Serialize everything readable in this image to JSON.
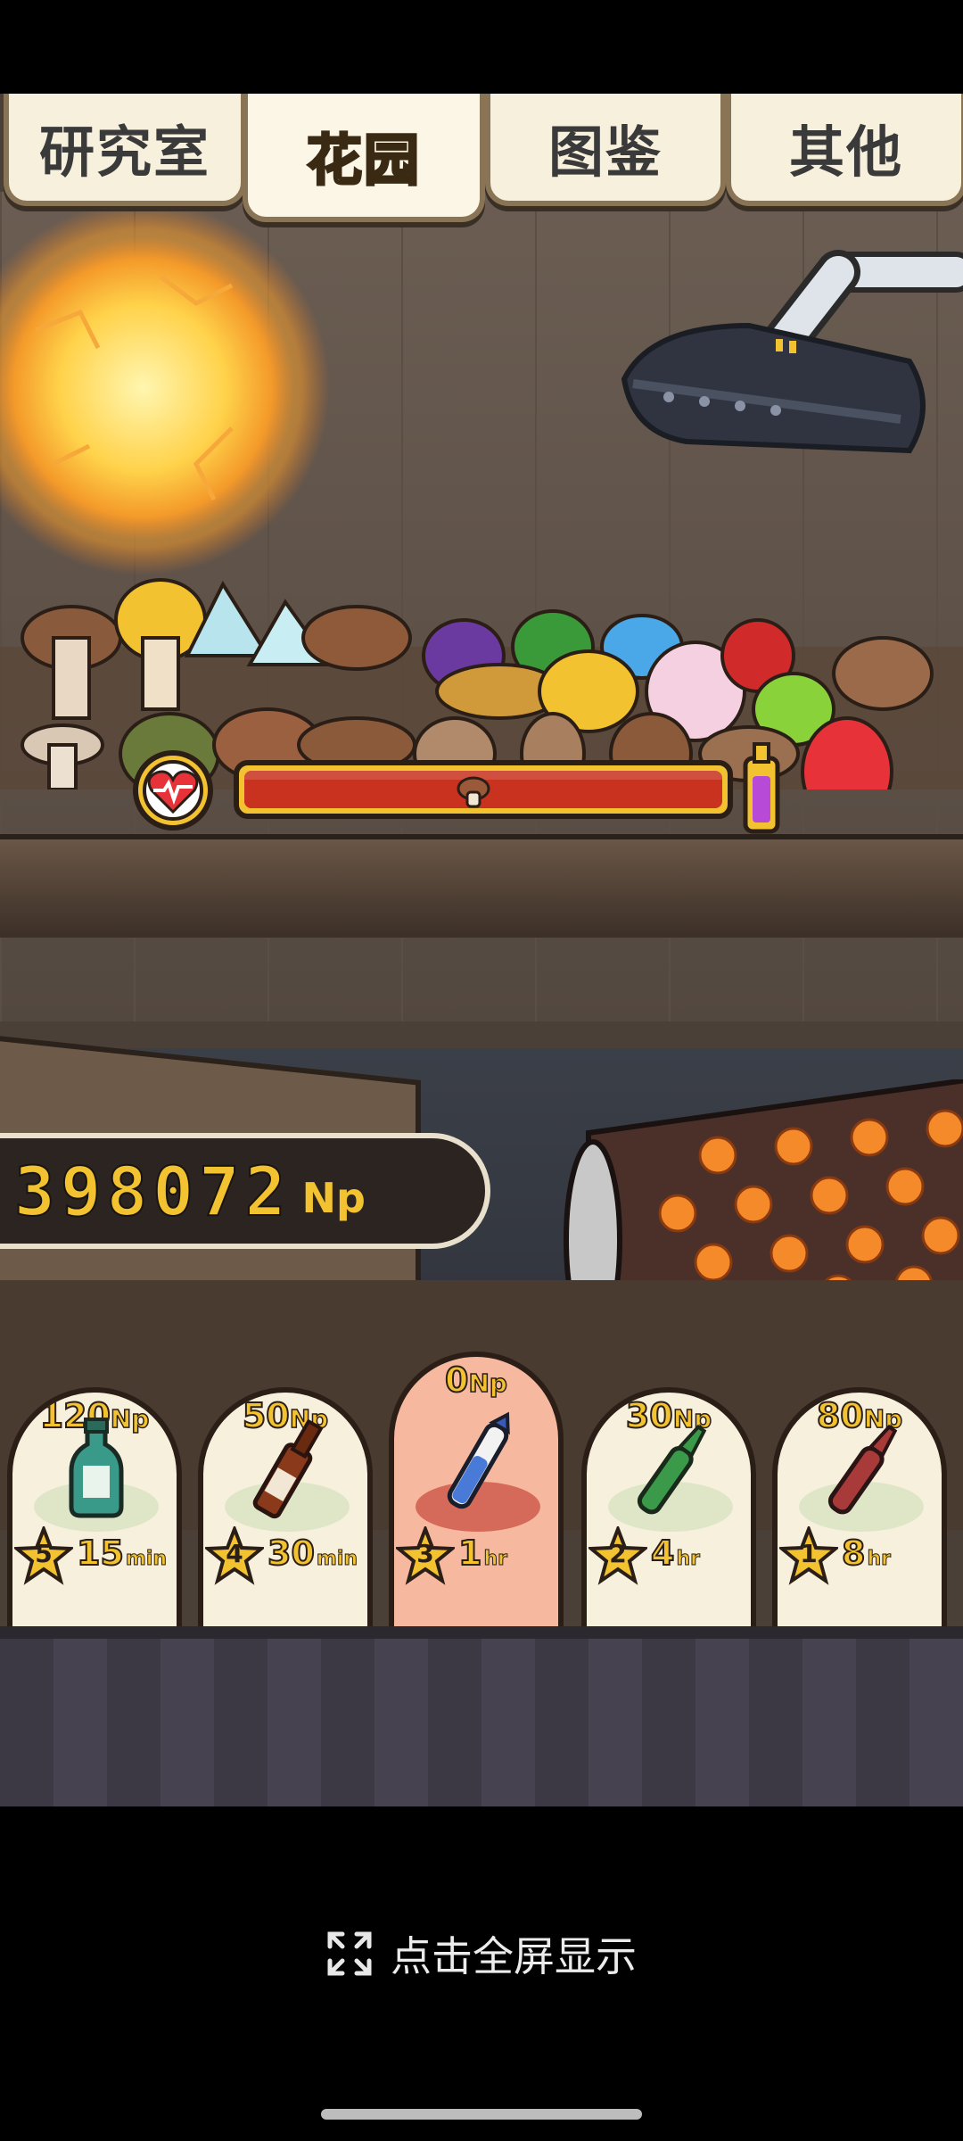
{
  "tabs": [
    {
      "label": "研究室",
      "active": false
    },
    {
      "label": "花园",
      "active": true
    },
    {
      "label": "图鉴",
      "active": false
    },
    {
      "label": "其他",
      "active": false
    }
  ],
  "currency": {
    "amount": "398072",
    "unit": "Np"
  },
  "health_bar": {
    "level": 0.48
  },
  "shop_items": [
    {
      "price": "120",
      "unit": "Np",
      "stars": "5",
      "time": "15",
      "time_unit": "min",
      "icon": "green-bottle-icon",
      "highlighted": false
    },
    {
      "price": "50",
      "unit": "Np",
      "stars": "4",
      "time": "30",
      "time_unit": "min",
      "icon": "brown-bottle-icon",
      "highlighted": false
    },
    {
      "price": "0",
      "unit": "Np",
      "stars": "3",
      "time": "1",
      "time_unit": "hr",
      "icon": "blue-vial-icon",
      "highlighted": true
    },
    {
      "price": "30",
      "unit": "Np",
      "stars": "2",
      "time": "4",
      "time_unit": "hr",
      "icon": "green-ampoule-icon",
      "highlighted": false
    },
    {
      "price": "80",
      "unit": "Np",
      "stars": "1",
      "time": "8",
      "time_unit": "hr",
      "icon": "red-ampoule-icon",
      "highlighted": false
    }
  ],
  "fullscreen_hint": "点击全屏显示",
  "colors": {
    "tab_active": "#f2c230",
    "bar_fill": "#c8321e",
    "card_highlight": "#f7b8a0"
  }
}
